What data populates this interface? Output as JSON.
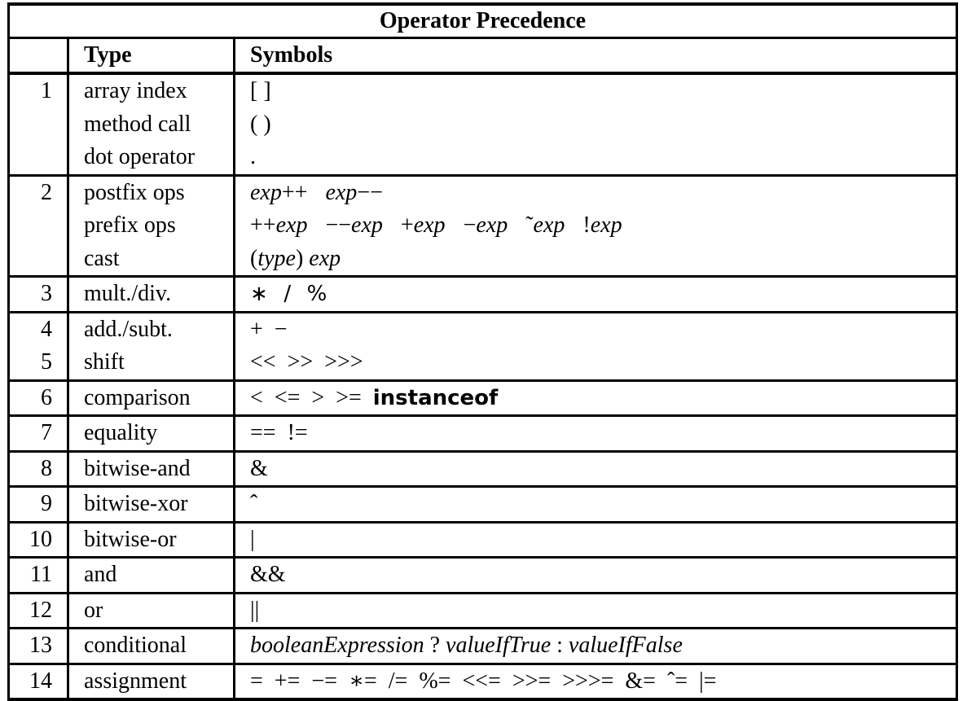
{
  "title": "Operator Precedence",
  "headers": {
    "num": "",
    "type": "Type",
    "symbols": "Symbols"
  },
  "groups": [
    {
      "levels": [
        "1"
      ],
      "rows": [
        {
          "type": "array index",
          "symbols": [
            {
              "t": "[ ]",
              "s": "r"
            }
          ]
        },
        {
          "type": "method call",
          "symbols": [
            {
              "t": "( )",
              "s": "r"
            }
          ]
        },
        {
          "type": "dot operator",
          "symbols": [
            {
              "t": ".",
              "s": "r"
            }
          ]
        }
      ]
    },
    {
      "levels": [
        "2"
      ],
      "rows": [
        {
          "type": "postfix ops",
          "symbols": [
            {
              "t": "exp",
              "s": "i"
            },
            {
              "t": "++",
              "s": "r"
            },
            {
              "t": " ",
              "s": "sp"
            },
            {
              "t": "exp",
              "s": "i"
            },
            {
              "t": "−−",
              "s": "r"
            }
          ]
        },
        {
          "type": "prefix ops",
          "symbols": [
            {
              "t": "++",
              "s": "r"
            },
            {
              "t": "exp",
              "s": "i"
            },
            {
              "t": " ",
              "s": "sp"
            },
            {
              "t": "−−",
              "s": "r"
            },
            {
              "t": "exp",
              "s": "i"
            },
            {
              "t": " ",
              "s": "sp"
            },
            {
              "t": "+",
              "s": "r"
            },
            {
              "t": "exp",
              "s": "i"
            },
            {
              "t": " ",
              "s": "sp"
            },
            {
              "t": "−",
              "s": "r"
            },
            {
              "t": "exp",
              "s": "i"
            },
            {
              "t": " ",
              "s": "sp"
            },
            {
              "t": "˜",
              "s": "r"
            },
            {
              "t": "exp",
              "s": "i"
            },
            {
              "t": " ",
              "s": "sp"
            },
            {
              "t": "!",
              "s": "r"
            },
            {
              "t": "exp",
              "s": "i"
            }
          ]
        },
        {
          "type": "cast",
          "symbols": [
            {
              "t": "(",
              "s": "r"
            },
            {
              "t": "type",
              "s": "i"
            },
            {
              "t": ") ",
              "s": "r"
            },
            {
              "t": "exp",
              "s": "i"
            }
          ]
        }
      ]
    },
    {
      "levels": [
        "3"
      ],
      "rows": [
        {
          "type": "mult./div.",
          "symbols": [
            {
              "t": "∗  /  %",
              "s": "o"
            }
          ]
        }
      ]
    },
    {
      "levels": [
        "4",
        "5"
      ],
      "rows": [
        {
          "type": "add./subt.",
          "symbols": [
            {
              "t": "+  −",
              "s": "r"
            }
          ]
        },
        {
          "type": "shift",
          "symbols": [
            {
              "t": "<<  >>  >>>",
              "s": "r"
            }
          ]
        }
      ]
    },
    {
      "levels": [
        "6"
      ],
      "rows": [
        {
          "type": "comparison",
          "symbols": [
            {
              "t": "<  <=  >  >=  ",
              "s": "r"
            },
            {
              "t": "instanceof",
              "s": "k"
            }
          ]
        }
      ]
    },
    {
      "levels": [
        "7"
      ],
      "rows": [
        {
          "type": "equality",
          "symbols": [
            {
              "t": "==  !=",
              "s": "r"
            }
          ]
        }
      ]
    },
    {
      "levels": [
        "8"
      ],
      "rows": [
        {
          "type": "bitwise-and",
          "symbols": [
            {
              "t": "&",
              "s": "r"
            }
          ]
        }
      ]
    },
    {
      "levels": [
        "9"
      ],
      "rows": [
        {
          "type": "bitwise-xor",
          "symbols": [
            {
              "t": "ˆ",
              "s": "r"
            }
          ]
        }
      ]
    },
    {
      "levels": [
        "10"
      ],
      "rows": [
        {
          "type": "bitwise-or",
          "symbols": [
            {
              "t": "|",
              "s": "r"
            }
          ]
        }
      ]
    },
    {
      "levels": [
        "11"
      ],
      "rows": [
        {
          "type": "and",
          "symbols": [
            {
              "t": "&&",
              "s": "r"
            }
          ]
        }
      ]
    },
    {
      "levels": [
        "12"
      ],
      "rows": [
        {
          "type": "or",
          "symbols": [
            {
              "t": "||",
              "s": "r"
            }
          ]
        }
      ]
    },
    {
      "levels": [
        "13"
      ],
      "rows": [
        {
          "type": "conditional",
          "symbols": [
            {
              "t": "booleanExpression",
              "s": "i"
            },
            {
              "t": " ? ",
              "s": "r"
            },
            {
              "t": "valueIfTrue",
              "s": "i"
            },
            {
              "t": " : ",
              "s": "r"
            },
            {
              "t": "valueIfFalse",
              "s": "i"
            }
          ]
        }
      ]
    },
    {
      "levels": [
        "14"
      ],
      "rows": [
        {
          "type": "assignment",
          "symbols": [
            {
              "t": "=  +=  −=  ∗=  /=  %=  <<=  >>=  >>>=  &=  ˆ=  |=",
              "s": "r"
            }
          ]
        }
      ]
    }
  ]
}
